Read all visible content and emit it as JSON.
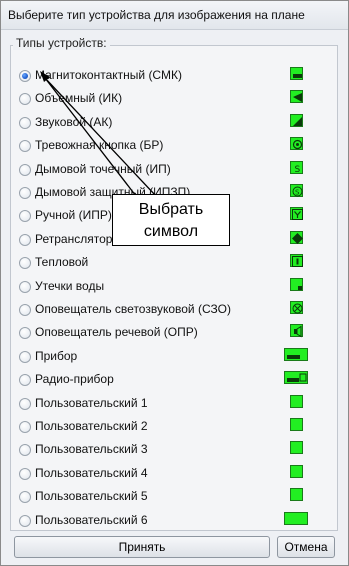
{
  "title": "Выберите тип устройства для изображения на плане",
  "group_label": "Типы устройств:",
  "devices": [
    {
      "label": "Магнитоконтактный (СМК)",
      "checked": true,
      "icon": "rect-small-icon"
    },
    {
      "label": "Объемный (ИК)",
      "checked": false,
      "icon": "triangle-left-icon"
    },
    {
      "label": "Звуковой (АК)",
      "checked": false,
      "icon": "diagonal-triangle-icon"
    },
    {
      "label": "Тревожная кнопка (БР)",
      "checked": false,
      "icon": "circle-dot-icon"
    },
    {
      "label": "Дымовой точечный (ИП)",
      "checked": false,
      "icon": "s-symbol-icon"
    },
    {
      "label": "Дымовой защитный (ИПЗП)",
      "checked": false,
      "icon": "s-circle-icon"
    },
    {
      "label": "Ручной (ИПР)",
      "checked": false,
      "icon": "y-symbol-icon"
    },
    {
      "label": "Ретранслятор",
      "checked": false,
      "icon": "diamond-icon"
    },
    {
      "label": "Тепловой",
      "checked": false,
      "icon": "i-symbol-icon"
    },
    {
      "label": "Утечки воды",
      "checked": false,
      "icon": "corner-square-icon"
    },
    {
      "label": "Оповещатель светозвуковой (СЗО)",
      "checked": false,
      "icon": "circle-x-icon"
    },
    {
      "label": "Оповещатель речевой (ОПР)",
      "checked": false,
      "icon": "speaker-icon"
    },
    {
      "label": "Прибор",
      "checked": false,
      "icon": "device-wide-icon"
    },
    {
      "label": "Радио-прибор",
      "checked": false,
      "icon": "radio-device-icon"
    },
    {
      "label": "Пользовательский 1",
      "checked": false,
      "icon": "square-icon"
    },
    {
      "label": "Пользовательский 2",
      "checked": false,
      "icon": "square-icon"
    },
    {
      "label": "Пользовательский 3",
      "checked": false,
      "icon": "square-icon"
    },
    {
      "label": "Пользовательский 4",
      "checked": false,
      "icon": "square-icon"
    },
    {
      "label": "Пользовательский 5",
      "checked": false,
      "icon": "square-icon"
    },
    {
      "label": "Пользовательский 6",
      "checked": false,
      "icon": "wide-rect-icon"
    }
  ],
  "callout_line1": "Выбрать",
  "callout_line2": "символ",
  "accept_label": "Принять",
  "cancel_label": "Отмена",
  "colors": {
    "symbol_fill": "#22ee22",
    "symbol_border": "#1a7a1a",
    "radio_selected": "#1f5fd0"
  }
}
